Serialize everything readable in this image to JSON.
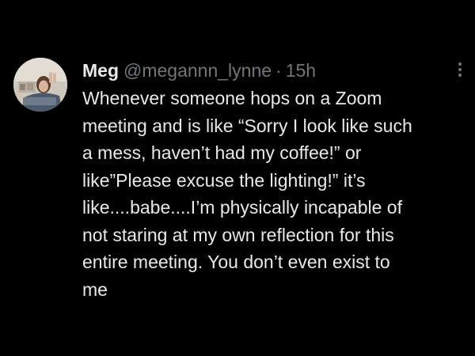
{
  "tweet": {
    "display_name": "Meg",
    "handle": "@megannn_lynne",
    "separator": "·",
    "timestamp": "15h",
    "more_icon": "more-vertical-icon",
    "text": "Whenever someone hops on a Zoom\nmeeting and is like “Sorry I look like such\na mess, haven’t had my coffee!” or\nlike”Please excuse the lighting!” it’s\nlike....babe....I’m physically incapable of\nnot staring at my own reflection for this\nentire meeting. You don’t even exist to\nme"
  },
  "colors": {
    "background": "#000000",
    "primary_text": "#e7e9ea",
    "secondary_text": "#71767b"
  }
}
